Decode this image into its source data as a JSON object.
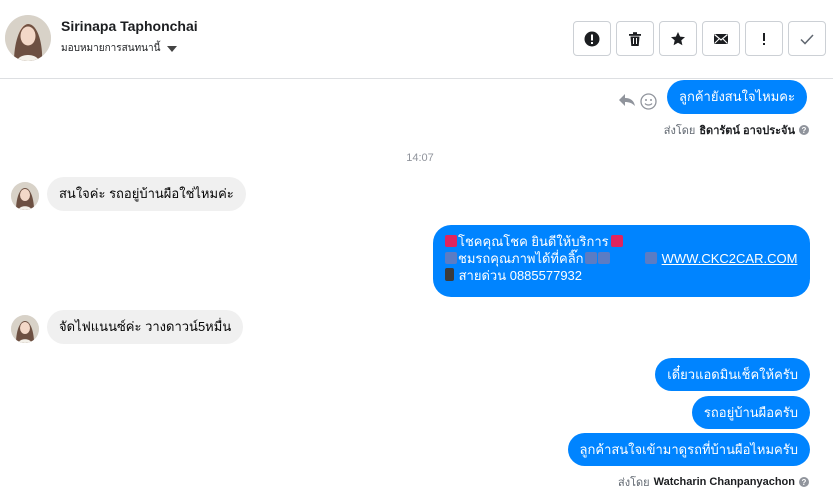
{
  "header": {
    "contact_name": "Sirinapa Taphonchai",
    "assign_label": "มอบหมายการสนทนานี้"
  },
  "actions": [
    {
      "name": "spam-button",
      "icon": "alert-circle-icon"
    },
    {
      "name": "delete-button",
      "icon": "trash-icon"
    },
    {
      "name": "star-button",
      "icon": "star-icon"
    },
    {
      "name": "mark-unread-button",
      "icon": "envelope-icon"
    },
    {
      "name": "follow-up-button",
      "icon": "exclamation-icon"
    },
    {
      "name": "mark-done-button",
      "icon": "check-icon"
    }
  ],
  "messages": {
    "m1": {
      "text": "ลูกค้ายังสนใจไหมคะ"
    },
    "sent_by_1": {
      "prefix": "ส่งโดย",
      "name": "ธิดารัตน์ อาจประจัน"
    },
    "timestamp": "14:07",
    "m2": {
      "text": "สนใจค่ะ รถอยู่บ้านผือใช่ไหมค่ะ"
    },
    "m3": {
      "line1": "โชคคุณโชค ยินดีให้บริการ",
      "line2": "ชมรถคุณภาพได้ที่คลิ๊ก",
      "link": "WWW.CKC2CAR.COM",
      "line3": "สายด่วน 0885577932"
    },
    "m4": {
      "text": "จัดไฟแนนซ์ค่ะ วางดาวน์5หมื่น"
    },
    "m5": {
      "text": "เดี๋ยวแอดมินเช็คให้ครับ"
    },
    "m6": {
      "text": "รถอยู่บ้านผือครับ"
    },
    "m7": {
      "text": "ลูกค้าสนใจเข้ามาดูรถที่บ้านผือไหมครับ"
    },
    "sent_by_2": {
      "prefix": "ส่งโดย",
      "name": "Watcharin Chanpanyachon"
    }
  },
  "colors": {
    "outgoing": "#0084ff",
    "incoming": "#f0f0f0"
  }
}
